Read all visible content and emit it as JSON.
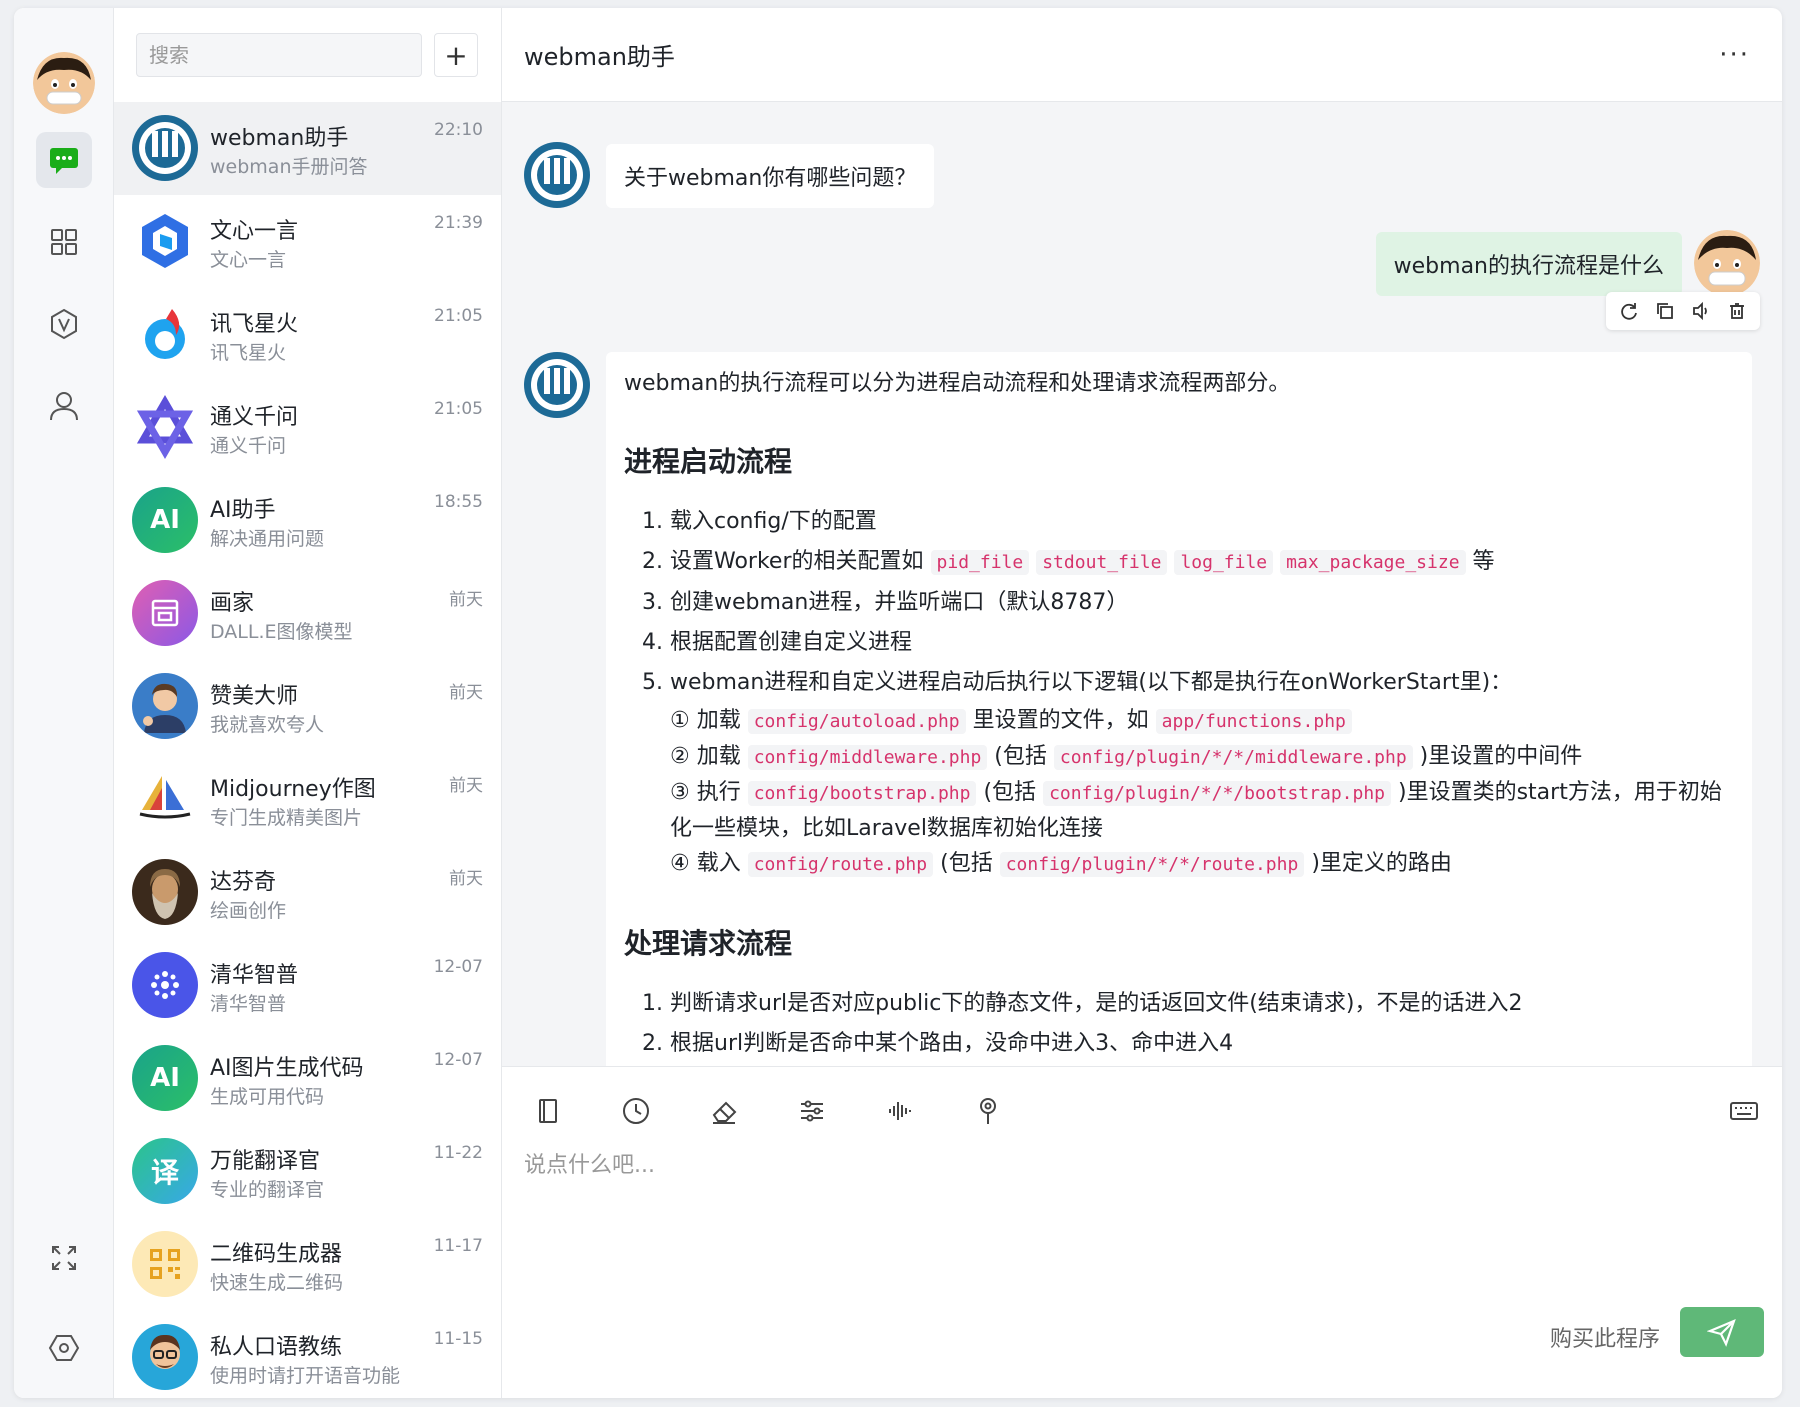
{
  "search": {
    "placeholder": "搜索",
    "add_label": "+"
  },
  "contacts": [
    {
      "name": "webman助手",
      "sub": "webman手册问答",
      "time": "22:10",
      "icon": "webman-logo-icon"
    },
    {
      "name": "文心一言",
      "sub": "文心一言",
      "time": "21:39",
      "icon": "wenxin-logo-icon"
    },
    {
      "name": "讯飞星火",
      "sub": "讯飞星火",
      "time": "21:05",
      "icon": "xunfei-logo-icon"
    },
    {
      "name": "通义千问",
      "sub": "通义千问",
      "time": "21:05",
      "icon": "tongyi-logo-icon"
    },
    {
      "name": "AI助手",
      "sub": "解决通用问题",
      "time": "18:55",
      "icon": "ai-badge-icon",
      "badge": "AI"
    },
    {
      "name": "画家",
      "sub": "DALL.E图像模型",
      "time": "前天",
      "icon": "painter-icon"
    },
    {
      "name": "赞美大师",
      "sub": "我就喜欢夸人",
      "time": "前天",
      "icon": "praise-avatar"
    },
    {
      "name": "Midjourney作图",
      "sub": "专门生成精美图片",
      "time": "前天",
      "icon": "midjourney-sailboat-icon"
    },
    {
      "name": "达芬奇",
      "sub": "绘画创作",
      "time": "前天",
      "icon": "davinci-avatar"
    },
    {
      "name": "清华智普",
      "sub": "清华智普",
      "time": "12-07",
      "icon": "zhipu-logo-icon"
    },
    {
      "name": "AI图片生成代码",
      "sub": "生成可用代码",
      "time": "12-07",
      "icon": "ai-badge-icon",
      "badge": "AI"
    },
    {
      "name": "万能翻译官",
      "sub": "专业的翻译官",
      "time": "11-22",
      "icon": "translate-badge-icon",
      "badge": "译"
    },
    {
      "name": "二维码生成器",
      "sub": "快速生成二维码",
      "time": "11-17",
      "icon": "qrcode-icon"
    },
    {
      "name": "私人口语教练",
      "sub": "使用时请打开语音功能",
      "time": "11-15",
      "icon": "coach-avatar"
    }
  ],
  "chat": {
    "title": "webman助手",
    "more": "···",
    "greeting": "关于webman你有哪些问题？",
    "user_question": "webman的执行流程是什么",
    "answer": {
      "intro": "webman的执行流程可以分为进程启动流程和处理请求流程两部分。",
      "section1_title": "进程启动流程",
      "s1_1": "载入config/下的配置",
      "s1_2_pre": "设置Worker的相关配置如",
      "s1_2_codes": [
        "pid_file",
        "stdout_file",
        "log_file",
        "max_package_size"
      ],
      "s1_2_post": "等",
      "s1_3": "创建webman进程，并监听端口（默认8787）",
      "s1_4": "根据配置创建自定义进程",
      "s1_5": "webman进程和自定义进程启动后执行以下逻辑(以下都是执行在onWorkerStart里)：",
      "sub1_pre": "① 加载",
      "sub1_code1": "config/autoload.php",
      "sub1_mid": "里设置的文件，如",
      "sub1_code2": "app/functions.php",
      "sub2_pre": "② 加载",
      "sub2_code1": "config/middleware.php",
      "sub2_mid": "(包括",
      "sub2_code2": "config/plugin/*/*/middleware.php",
      "sub2_post": ")里设置的中间件",
      "sub3_pre": "③ 执行",
      "sub3_code1": "config/bootstrap.php",
      "sub3_mid": "(包括",
      "sub3_code2": "config/plugin/*/*/bootstrap.php",
      "sub3_post": ")里设置类的start方法，用于初始化一些模块，比如Laravel数据库初始化连接",
      "sub4_pre": "④ 载入",
      "sub4_code1": "config/route.php",
      "sub4_mid": "(包括",
      "sub4_code2": "config/plugin/*/*/route.php",
      "sub4_post": ")里定义的路由",
      "section2_title": "处理请求流程",
      "s2_1": "判断请求url是否对应public下的静态文件，是的话返回文件(结束请求)，不是的话进入2",
      "s2_2": "根据url判断是否命中某个路由，没命中进入3、命中进入4"
    }
  },
  "composer": {
    "placeholder": "说点什么吧...",
    "buy_label": "购买此程序"
  },
  "colors": {
    "accent": "#5fb878",
    "active_nav": "#1aad19",
    "code": "#d6336c"
  }
}
